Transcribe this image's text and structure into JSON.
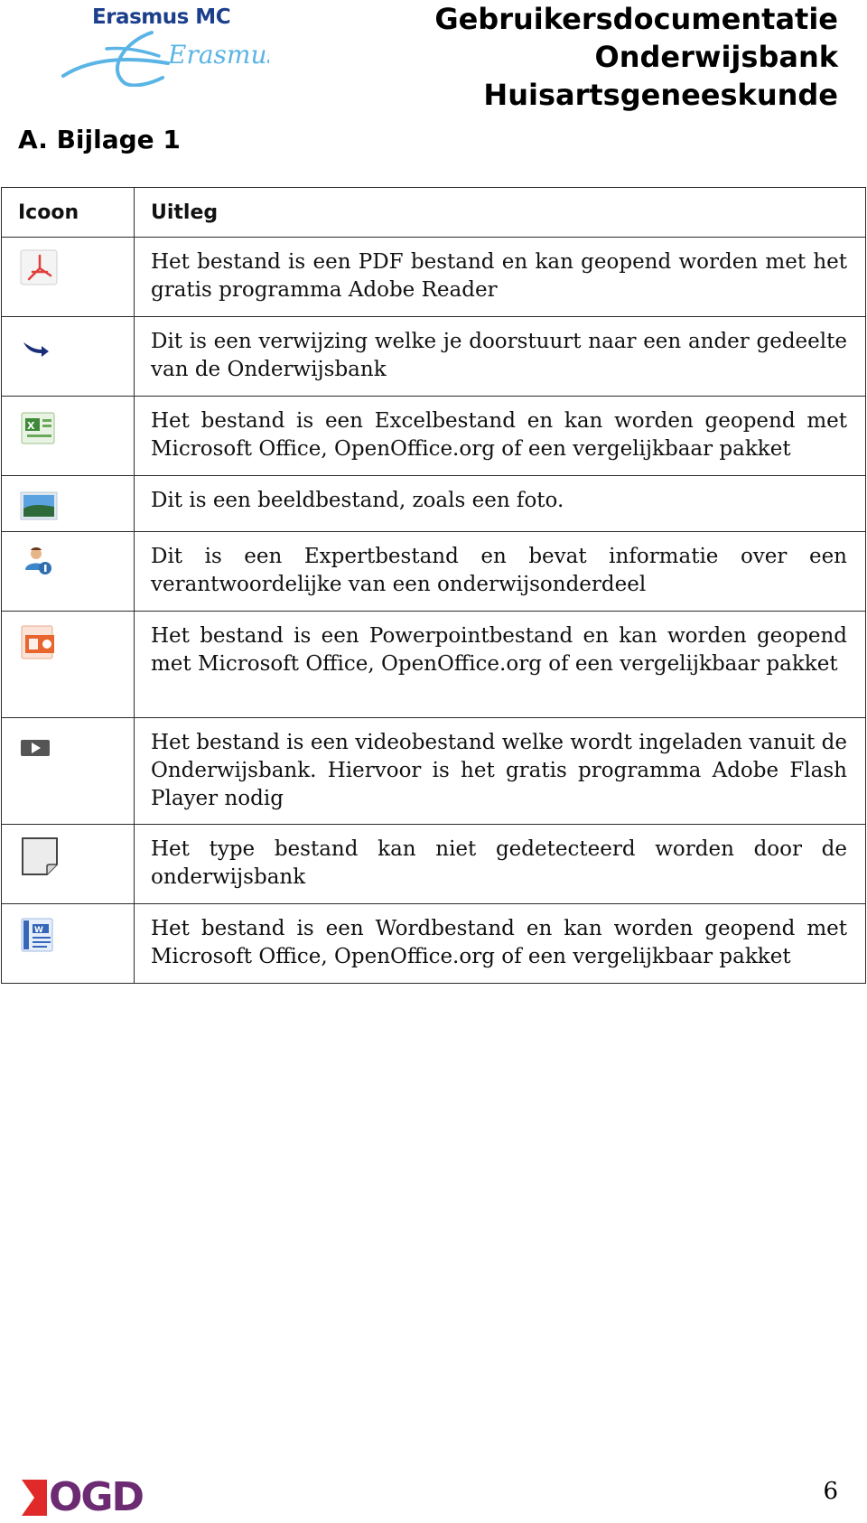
{
  "header": {
    "brand": "Erasmus MC",
    "signature": "Erasmus",
    "title_lines": [
      "Gebruikersdocumentatie",
      "Onderwijsbank",
      "Huisartsgeneeskunde"
    ]
  },
  "section": {
    "heading": "A. Bijlage 1"
  },
  "table": {
    "headers": [
      "Icoon",
      "Uitleg"
    ],
    "rows": [
      {
        "icon": "pdf-icon",
        "text": "Het bestand is een PDF bestand en kan geopend worden met het gratis programma Adobe Reader"
      },
      {
        "icon": "link-arrow-icon",
        "text": "Dit is een verwijzing welke je doorstuurt naar een ander gedeelte van de Onderwijsbank"
      },
      {
        "icon": "excel-icon",
        "text": "Het bestand is een Excelbestand en kan worden geopend met Microsoft Office, OpenOffice.org of een vergelijkbaar pakket"
      },
      {
        "icon": "image-icon",
        "text": "Dit is een beeldbestand, zoals een foto."
      },
      {
        "icon": "expert-icon",
        "text": "Dit is een Expertbestand en bevat informatie over een verantwoordelijke van een onderwijsonderdeel"
      },
      {
        "icon": "powerpoint-icon",
        "text": "Het bestand is een Powerpointbestand en kan worden geopend met Microsoft Office, OpenOffice.org of een vergelijkbaar pakket"
      },
      {
        "icon": "video-icon",
        "text": "Het bestand is een videobestand welke wordt ingeladen vanuit de Onderwijsbank. Hiervoor is het gratis programma Adobe Flash Player nodig"
      },
      {
        "icon": "unknown-file-icon",
        "text": "Het type bestand kan niet gedetecteerd worden door de onderwijsbank"
      },
      {
        "icon": "word-icon",
        "text": "Het bestand is een Wordbestand en kan worden geopend met Microsoft Office, OpenOffice.org of een vergelijkbaar pakket"
      }
    ]
  },
  "footer": {
    "logo": "OGD",
    "page_number": "6"
  },
  "colors": {
    "erasmus_blue": "#1c3f8c",
    "signature_blue": "#5ab4e5",
    "ogd_red": "#e02a2a",
    "ogd_purple": "#6b2a72"
  }
}
